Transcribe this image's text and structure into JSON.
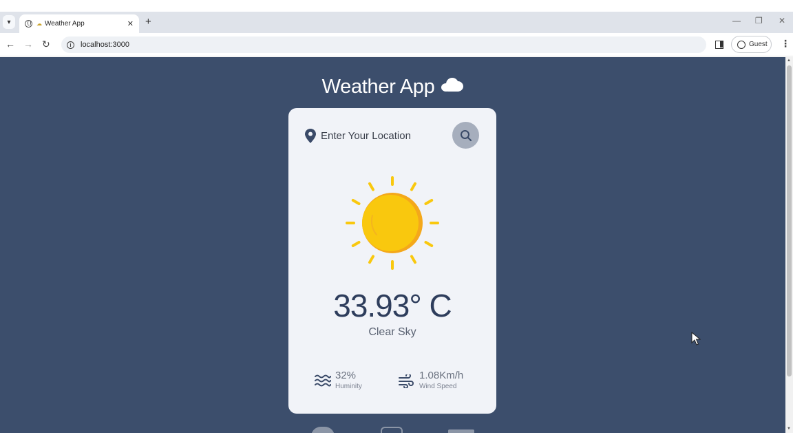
{
  "browser": {
    "tab_title": "Weather App",
    "url": "localhost:3000",
    "profile_label": "Guest",
    "icons": [
      "tab-search-icon",
      "globe-icon",
      "close-icon",
      "new-tab-icon",
      "back-icon",
      "forward-icon",
      "reload-icon",
      "site-info-icon",
      "side-panel-icon",
      "profile-icon",
      "menu-icon"
    ]
  },
  "app": {
    "title": "Weather App",
    "search": {
      "placeholder": "Enter Your Location",
      "value": ""
    },
    "weather": {
      "temperature": "33.93° C",
      "description": "Clear Sky",
      "icon": "sun-icon"
    },
    "stats": {
      "humidity": {
        "value": "32%",
        "label": "Huminity"
      },
      "wind": {
        "value": "1.08Km/h",
        "label": "Wind Speed"
      }
    },
    "colors": {
      "background": "#3c4e6c",
      "card": "#f1f3f8",
      "sun": "#f9c80e",
      "sun_shade": "#f4a81b",
      "accent_text": "#2e3d5c"
    }
  }
}
